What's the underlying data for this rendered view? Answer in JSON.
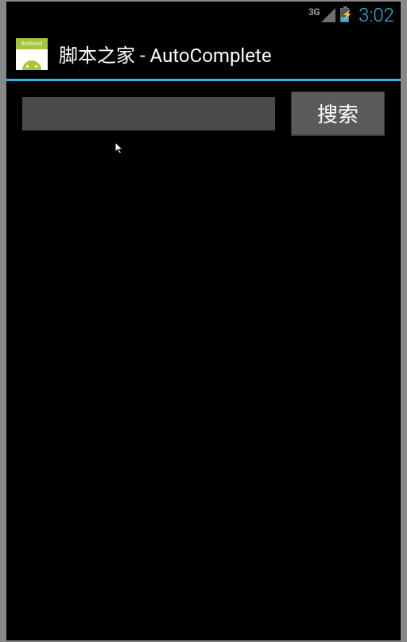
{
  "status_bar": {
    "network_type": "3G",
    "time": "3:02"
  },
  "action_bar": {
    "icon_tag": "Android",
    "title": "脚本之家 - AutoComplete"
  },
  "content": {
    "search_value": "",
    "search_button_label": "搜索"
  }
}
